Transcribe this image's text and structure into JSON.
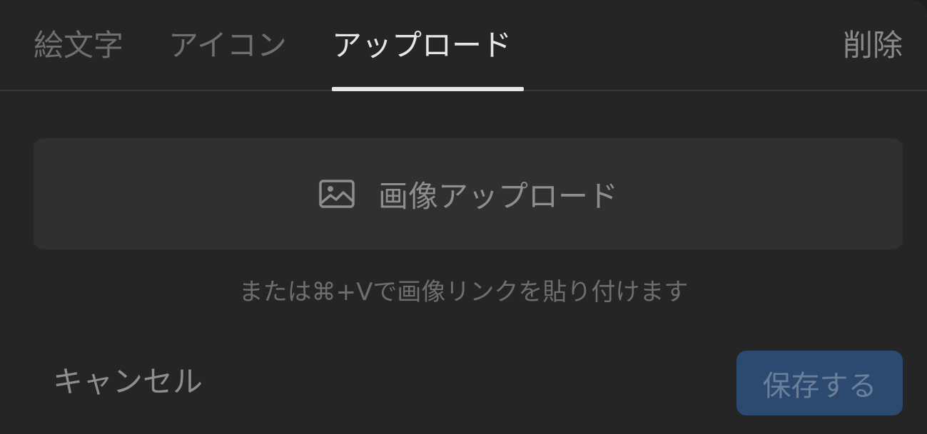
{
  "tabs": [
    {
      "label": "絵文字",
      "active": false
    },
    {
      "label": "アイコン",
      "active": false
    },
    {
      "label": "アップロード",
      "active": true
    }
  ],
  "remove_label": "削除",
  "upload": {
    "icon": "image-icon",
    "label": "画像アップロード"
  },
  "hint": "または⌘+Vで画像リンクを貼り付けます",
  "footer": {
    "cancel_label": "キャンセル",
    "save_label": "保存する"
  },
  "colors": {
    "panel_bg": "#252525",
    "upload_bg": "#303030",
    "active_tab": "#e6e6e6",
    "inactive_tab": "#6f6f6f",
    "save_bg": "#2c4a70",
    "save_text": "#6a7f99"
  }
}
